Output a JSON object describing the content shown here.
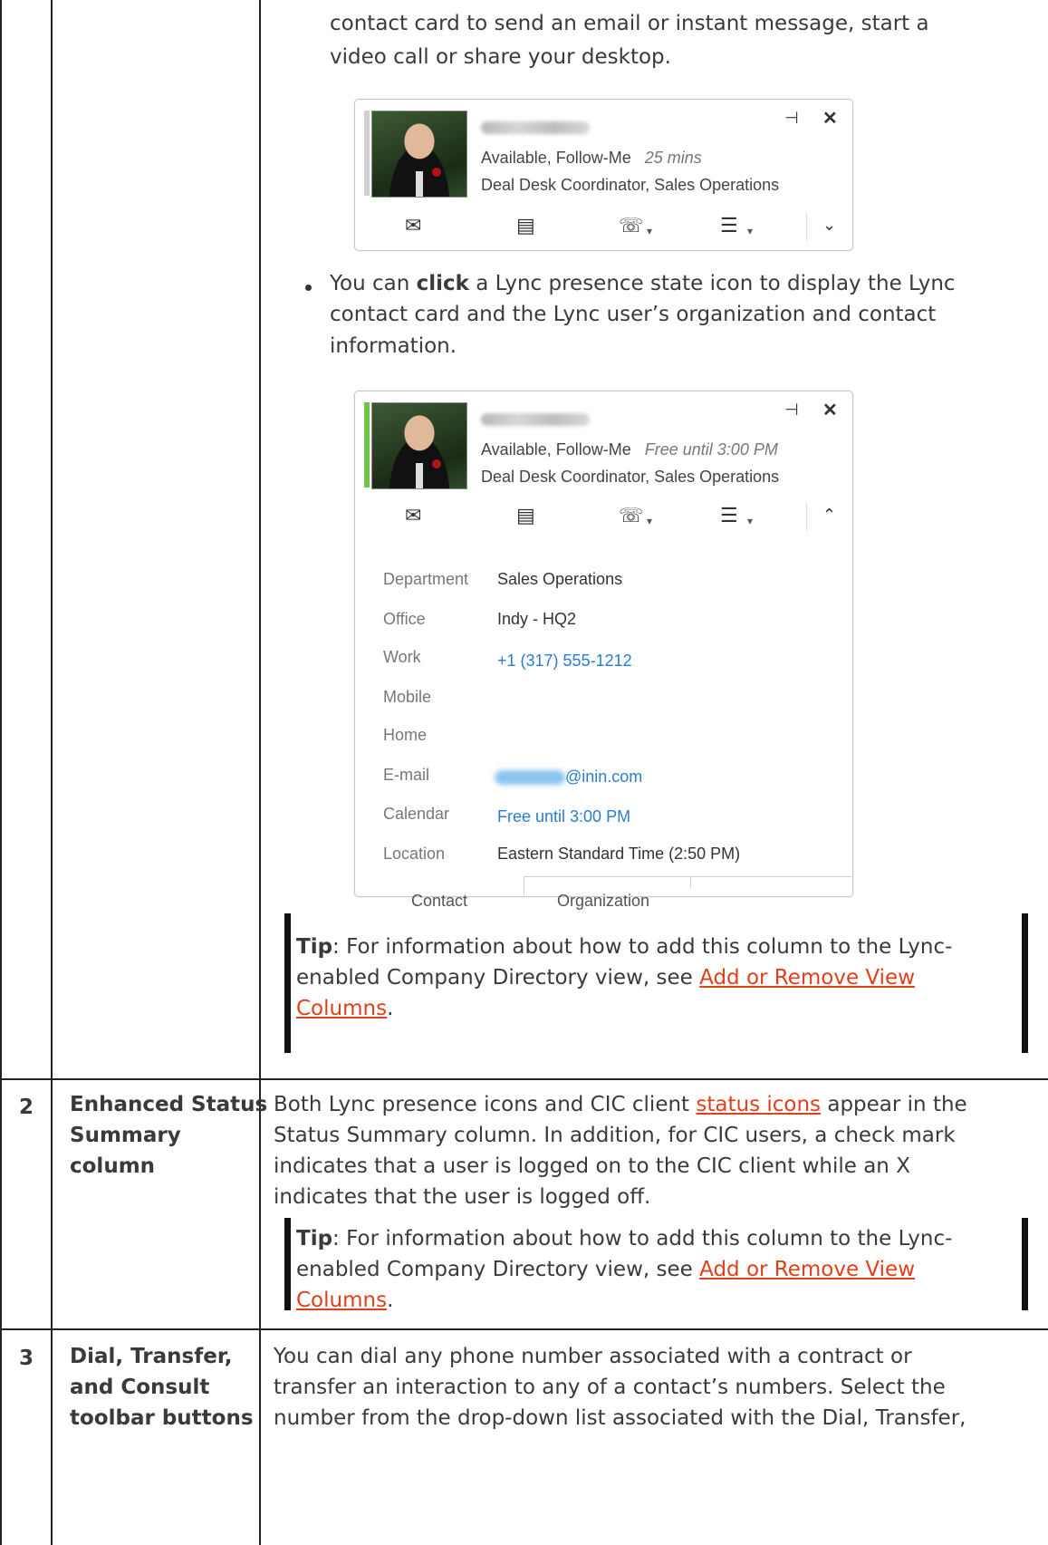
{
  "row1": {
    "intro_line1": "contact card to send an email or instant message, start a",
    "intro_line2": "video call or share your desktop.",
    "bullet_pre": "You can ",
    "bullet_bold": "click",
    "bullet_post": " a Lync presence state icon to display the Lync",
    "bullet_line2": "contact card and the Lync user’s organization and contact",
    "bullet_line3": "information.",
    "tip_label": "Tip",
    "tip_line1": ": For information about how to add this column to the Lync-",
    "tip_line2_pre": "enabled Company Directory view, see ",
    "tip_link_1": "Add or Remove View",
    "tip_link_2": "Columns",
    "tip_end": "."
  },
  "card1": {
    "status": "Available, Follow-Me",
    "time": "25 mins",
    "title": "Deal Desk Coordinator, Sales Operations",
    "pin_icon": "pin-icon",
    "close_icon": "close-icon",
    "actions": [
      "email-icon",
      "im-icon",
      "phone-icon",
      "video-icon",
      "chevron-down-icon"
    ]
  },
  "card2": {
    "status": "Available, Follow-Me",
    "time": "Free until 3:00 PM",
    "title": "Deal Desk Coordinator, Sales Operations",
    "presence_color": "#6fc34a",
    "details": [
      {
        "label": "Department",
        "value": "Sales Operations"
      },
      {
        "label": "Office",
        "value": "Indy - HQ2"
      },
      {
        "label": "Work",
        "value": "+1 (317) 555-1212"
      },
      {
        "label": "Mobile",
        "value": ""
      },
      {
        "label": "Home",
        "value": ""
      },
      {
        "label": "E-mail",
        "value": "@inin.com"
      },
      {
        "label": "Calendar",
        "value": "Free until 3:00 PM"
      },
      {
        "label": "Location",
        "value": "Eastern Standard Time (2:50 PM)"
      }
    ],
    "tabs": [
      "Contact",
      "Organization"
    ]
  },
  "row2": {
    "number": "2",
    "feature_1": "Enhanced Status",
    "feature_2": "Summary",
    "feature_3": "column",
    "desc_1_pre": "Both Lync presence icons and CIC client ",
    "desc_1_link": "status icons",
    "desc_1_post": " appear in the",
    "desc_2": "Status Summary column. In addition, for CIC users, a check mark",
    "desc_3": "indicates that a user is logged on to the CIC client while an X",
    "desc_4": "indicates that the user is logged off.",
    "tip_label": "Tip",
    "tip_line1": ": For information about how to add this column to the Lync-",
    "tip_line2_pre": "enabled Company Directory view, see ",
    "tip_link_1": "Add or Remove View",
    "tip_link_2": "Columns",
    "tip_end": "."
  },
  "row3": {
    "number": "3",
    "feature_1": "Dial, Transfer,",
    "feature_2": "and Consult",
    "feature_3": "toolbar buttons",
    "desc_1": "You can dial any phone number associated with a contract or",
    "desc_2": "transfer an interaction to any of a contact’s numbers. Select the",
    "desc_3": "number from the drop-down list associated with the Dial, Transfer,"
  },
  "colors": {
    "link": "#e0401a",
    "blue_link": "#2b7cd3",
    "presence_green": "#6fc34a"
  }
}
